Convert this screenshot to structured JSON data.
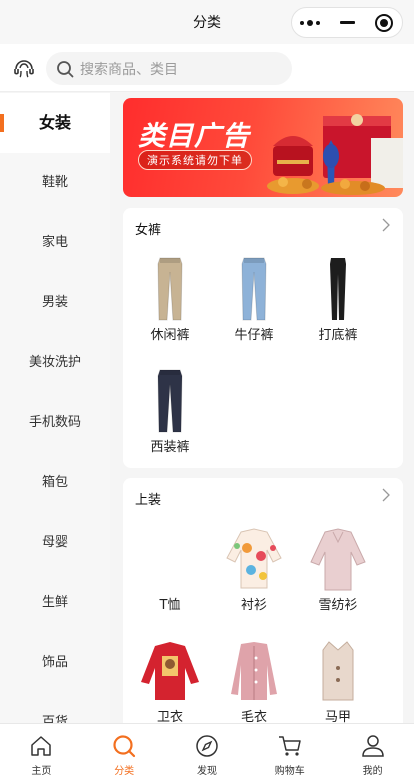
{
  "navbar": {
    "title": "分类",
    "capsule": {
      "more_icon": "more-dots-icon",
      "minimize_icon": "minimize-icon",
      "close_icon": "target-close-icon"
    }
  },
  "search": {
    "service_icon": "customer-service-icon",
    "placeholder": "搜索商品、类目"
  },
  "sidebar": {
    "active_index": 0,
    "items": [
      "女装",
      "鞋靴",
      "家电",
      "男装",
      "美妆洗护",
      "手机数码",
      "箱包",
      "母婴",
      "生鲜",
      "饰品",
      "百货"
    ]
  },
  "banner": {
    "title": "类目广告",
    "subtitle": "演示系统请勿下单"
  },
  "sections": [
    {
      "title": "女裤",
      "items": [
        {
          "label": "休闲裤",
          "icon": "khaki-pants-icon",
          "color": "#c7b393"
        },
        {
          "label": "牛仔裤",
          "icon": "jeans-icon",
          "color": "#8eb2d8"
        },
        {
          "label": "打底裤",
          "icon": "leggings-icon",
          "color": "#1d1d1d"
        },
        {
          "label": "西装裤",
          "icon": "suit-pants-icon",
          "color": "#2e3347"
        }
      ]
    },
    {
      "title": "上装",
      "items": [
        {
          "label": "T恤",
          "icon": "",
          "color": ""
        },
        {
          "label": "衬衫",
          "icon": "floral-shirt-icon",
          "color": "#f1a23d"
        },
        {
          "label": "雪纺衫",
          "icon": "chiffon-blouse-icon",
          "color": "#e9cfd0"
        },
        {
          "label": "卫衣",
          "icon": "red-sweatshirt-icon",
          "color": "#d4232f"
        },
        {
          "label": "毛衣",
          "icon": "pink-cardigan-icon",
          "color": "#dfa3aa"
        },
        {
          "label": "马甲",
          "icon": "vest-icon",
          "color": "#e8d8cc"
        }
      ]
    }
  ],
  "tabbar": {
    "active_index": 1,
    "accent": "#f36f1f",
    "items": [
      {
        "label": "主页",
        "icon": "home-icon"
      },
      {
        "label": "分类",
        "icon": "search-category-icon"
      },
      {
        "label": "发现",
        "icon": "compass-icon"
      },
      {
        "label": "购物车",
        "icon": "cart-icon"
      },
      {
        "label": "我的",
        "icon": "user-icon"
      }
    ]
  }
}
